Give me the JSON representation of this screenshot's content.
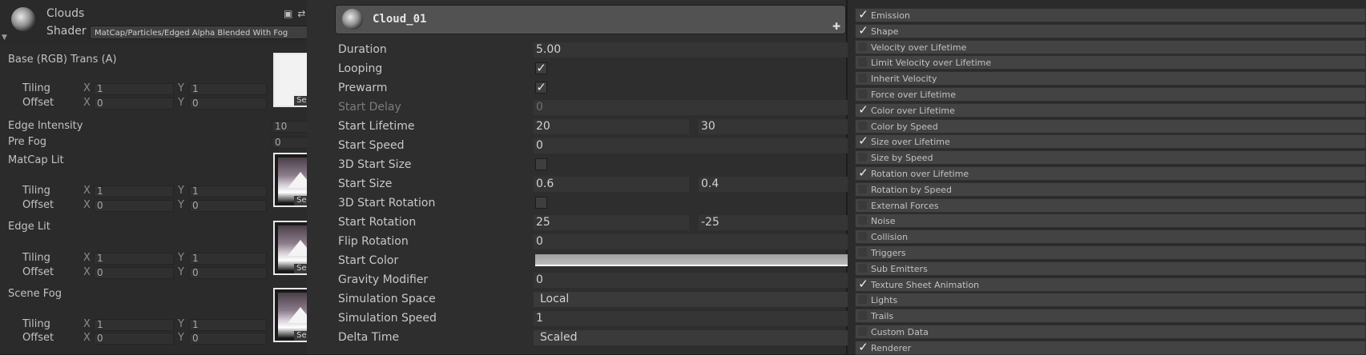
{
  "material": {
    "title": "Clouds",
    "shader_label": "Shader",
    "shader_value": "MatCap/Particles/Edged Alpha Blended With Fog",
    "header_icons": [
      "book-icon",
      "preset-icon",
      "gear-icon"
    ],
    "base_label": "Base (RGB) Trans (A)",
    "tiling_label": "Tiling",
    "offset_label": "Offset",
    "x_label": "X",
    "y_label": "Y",
    "select_label": "Select",
    "base": {
      "tiling_x": "1",
      "tiling_y": "1",
      "offset_x": "0",
      "offset_y": "0"
    },
    "edge_intensity_label": "Edge Intensity",
    "edge_intensity_value": "10",
    "pre_fog_label": "Pre Fog",
    "pre_fog_value": "0",
    "matcap_lit": {
      "label": "MatCap Lit",
      "tiling_x": "1",
      "tiling_y": "1",
      "offset_x": "0",
      "offset_y": "0"
    },
    "edge_lit": {
      "label": "Edge Lit",
      "tiling_x": "1",
      "tiling_y": "1",
      "offset_x": "0",
      "offset_y": "0"
    },
    "scene_fog": {
      "label": "Scene Fog",
      "tiling_x": "1",
      "tiling_y": "1",
      "offset_x": "0",
      "offset_y": "0"
    }
  },
  "particle": {
    "title": "Cloud_01",
    "add_icon": "plus-icon",
    "check_glyph": "✓",
    "rows": {
      "duration": {
        "label": "Duration",
        "value": "5.00"
      },
      "looping": {
        "label": "Looping",
        "checked": true
      },
      "prewarm": {
        "label": "Prewarm",
        "checked": true
      },
      "start_delay": {
        "label": "Start Delay",
        "value": "0"
      },
      "start_lifetime": {
        "label": "Start Lifetime",
        "min": "20",
        "max": "30"
      },
      "start_speed": {
        "label": "Start Speed",
        "value": "0"
      },
      "start_size_3d": {
        "label": "3D Start Size",
        "checked": false
      },
      "start_size": {
        "label": "Start Size",
        "min": "0.6",
        "max": "0.4"
      },
      "start_rotation_3d": {
        "label": "3D Start Rotation",
        "checked": false
      },
      "start_rotation": {
        "label": "Start Rotation",
        "min": "25",
        "max": "-25"
      },
      "flip_rotation": {
        "label": "Flip Rotation",
        "value": "0"
      },
      "start_color": {
        "label": "Start Color"
      },
      "gravity_modifier": {
        "label": "Gravity Modifier",
        "value": "0"
      },
      "simulation_space": {
        "label": "Simulation Space",
        "value": "Local"
      },
      "simulation_speed": {
        "label": "Simulation Speed",
        "value": "1"
      },
      "delta_time": {
        "label": "Delta Time",
        "value": "Scaled"
      }
    }
  },
  "modules": [
    {
      "label": "Emission",
      "enabled": true
    },
    {
      "label": "Shape",
      "enabled": true
    },
    {
      "label": "Velocity over Lifetime",
      "enabled": false
    },
    {
      "label": "Limit Velocity over Lifetime",
      "enabled": false
    },
    {
      "label": "Inherit Velocity",
      "enabled": false
    },
    {
      "label": "Force over Lifetime",
      "enabled": false
    },
    {
      "label": "Color over Lifetime",
      "enabled": true
    },
    {
      "label": "Color by Speed",
      "enabled": false
    },
    {
      "label": "Size over Lifetime",
      "enabled": true
    },
    {
      "label": "Size by Speed",
      "enabled": false
    },
    {
      "label": "Rotation over Lifetime",
      "enabled": true
    },
    {
      "label": "Rotation by Speed",
      "enabled": false
    },
    {
      "label": "External Forces",
      "enabled": false
    },
    {
      "label": "Noise",
      "enabled": false
    },
    {
      "label": "Collision",
      "enabled": false
    },
    {
      "label": "Triggers",
      "enabled": false
    },
    {
      "label": "Sub Emitters",
      "enabled": false
    },
    {
      "label": "Texture Sheet Animation",
      "enabled": true
    },
    {
      "label": "Lights",
      "enabled": false
    },
    {
      "label": "Trails",
      "enabled": false
    },
    {
      "label": "Custom Data",
      "enabled": false
    },
    {
      "label": "Renderer",
      "enabled": true
    }
  ]
}
